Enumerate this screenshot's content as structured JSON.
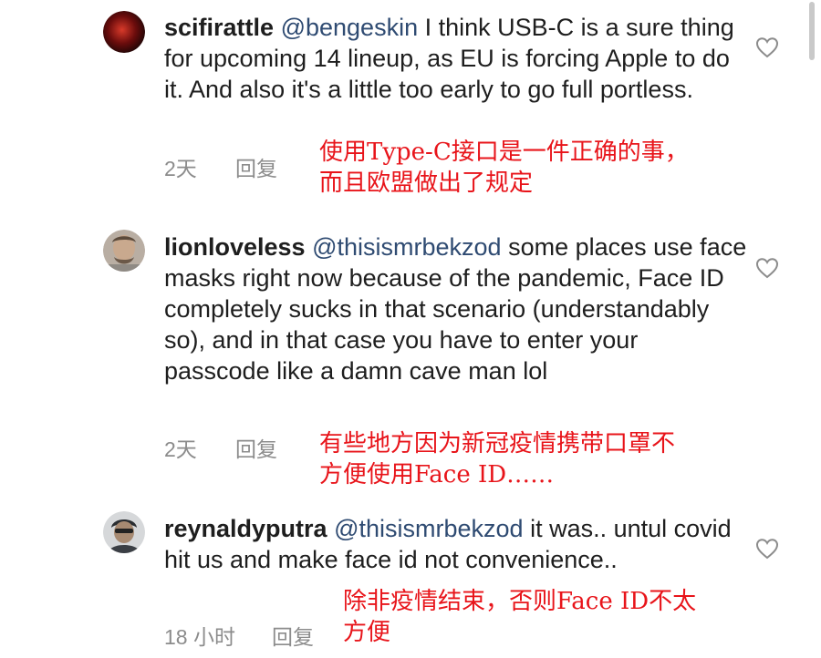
{
  "comments": [
    {
      "username": "scifirattle",
      "mention": "@bengeskin",
      "text": " I think USB-C is a sure thing for upcoming 14 lineup, as EU is forcing Apple to do it. And also it's a little too early to go full portless.",
      "time": "2天",
      "reply": "回复",
      "annotation": "使用Type-C接口是一件正确的事，\n而且欧盟做出了规定",
      "avatar_color": "#7a1010"
    },
    {
      "username": "lionloveless",
      "mention": "@thisismrbekzod",
      "text": " some places use face masks right now because of the pandemic, Face ID completely sucks in that scenario (understandably so), and in that case you have to enter your passcode like a damn cave man lol",
      "time": "2天",
      "reply": "回复",
      "annotation": "有些地方因为新冠疫情携带口罩不\n方便使用Face ID……",
      "avatar_color": "#9a8f86"
    },
    {
      "username": "reynaldyputra",
      "mention": "@thisismrbekzod",
      "text": " it was.. untul covid hit us and make face id not convenience..",
      "time": "18 小时",
      "reply": "回复",
      "annotation": "除非疫情结束，否则Face ID不太\n方便",
      "avatar_color": "#5a5f66"
    }
  ],
  "icons": {
    "like": "heart-outline-icon"
  },
  "colors": {
    "mention": "#2f4b72",
    "annotation": "#e8141a",
    "meta": "#8c8c8c"
  }
}
